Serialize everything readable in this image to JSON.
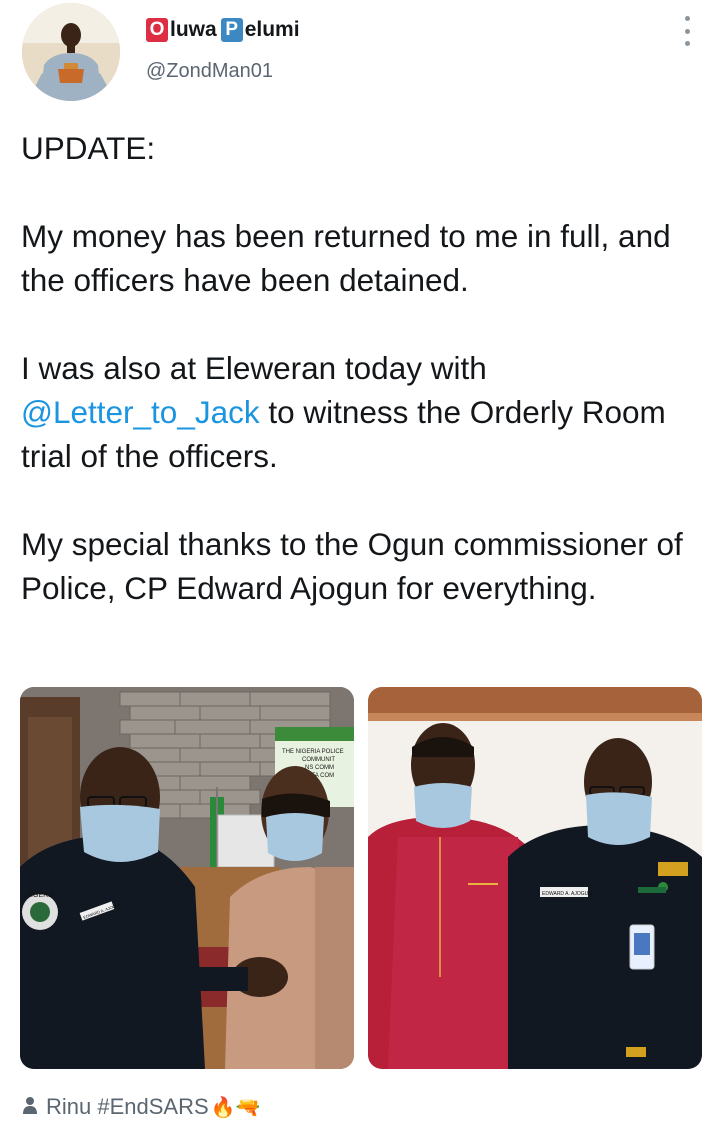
{
  "author": {
    "name_first_letter": "O",
    "name_part1": "luwa",
    "name_second_letter": "P",
    "name_part2": "elumi",
    "handle": "@ZondMan01"
  },
  "tweet": {
    "line1": "UPDATE:",
    "para2": "My money has been returned to me in full, and the officers have been detained.",
    "para3_before": "I was also at Eleweran today with ",
    "para3_mention": "@Letter_to_Jack",
    "para3_after": " to witness the Orderly Room trial of the officers.",
    "para4": "My special thanks to the Ogun commissioner of Police, CP Edward Ajogun for everything."
  },
  "media": {
    "left_sign_lines": [
      "THE NIGERIA POLICE",
      "COMMUNIT",
      "NS COMM",
      "ATA COM"
    ],
    "left_badge": "NIGERIA",
    "left_nametag": "EDWARD A. AJOGUN",
    "right_nametag": "EDWARD A. AJOGUN"
  },
  "footer": {
    "text": "Rinu #EndSARS",
    "emoji": "🔥🔫"
  },
  "colors": {
    "mention": "#1b95e0",
    "muted": "#5b6670",
    "letter_red": "#dd2e44",
    "letter_blue": "#3b88c3"
  }
}
